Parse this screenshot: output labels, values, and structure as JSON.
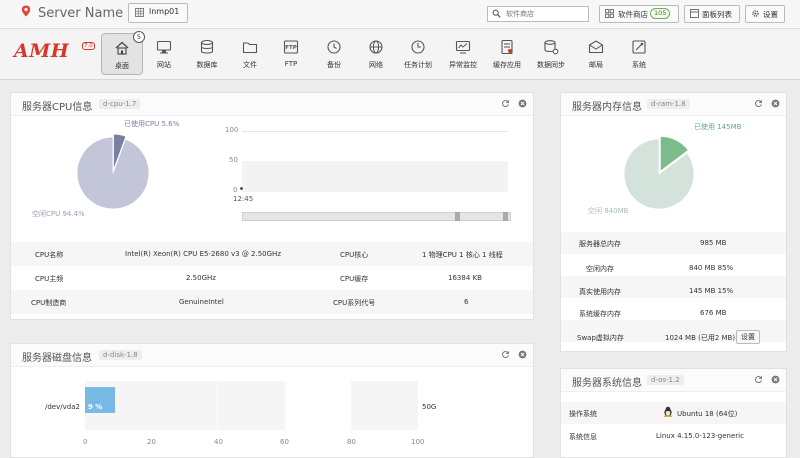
{
  "topbar": {
    "server_name": "Server Name",
    "host": "lnmp01",
    "search_placeholder": "软件商店",
    "store_label": "软件商店",
    "store_count": "105",
    "panel_list_label": "面板列表",
    "settings_label": "设置"
  },
  "logo": {
    "text": "AMH",
    "version": "7.0"
  },
  "nav": {
    "items": [
      {
        "label": "桌面",
        "icon": "desktop-icon",
        "badge": "5",
        "active": true
      },
      {
        "label": "网站",
        "icon": "monitor-icon"
      },
      {
        "label": "数据库",
        "icon": "database-icon"
      },
      {
        "label": "文件",
        "icon": "folder-icon"
      },
      {
        "label": "FTP",
        "icon": "ftp-icon"
      },
      {
        "label": "备份",
        "icon": "backup-icon"
      },
      {
        "label": "网络",
        "icon": "globe-icon"
      },
      {
        "label": "任务计划",
        "icon": "clock-icon"
      },
      {
        "label": "异常监控",
        "icon": "monitor-chart-icon"
      },
      {
        "label": "缓存应用",
        "icon": "cache-icon"
      },
      {
        "label": "数据同步",
        "icon": "sync-icon"
      },
      {
        "label": "邮局",
        "icon": "mail-icon"
      },
      {
        "label": "系统",
        "icon": "system-icon"
      }
    ]
  },
  "cpu_panel": {
    "title": "服务器CPU信息",
    "tag": "d-cpu-1.7",
    "used_label": "已使用CPU 5.6%",
    "free_label": "空闲CPU 94.4%",
    "y_ticks": [
      "100",
      "50",
      "0"
    ],
    "x_tick": "12:45",
    "rows": [
      {
        "k1": "CPU名称",
        "v1": "Intel(R) Xeon(R) CPU E5-2680 v3 @ 2.50GHz",
        "k2": "CPU核心",
        "v2": "1 物理CPU   1 核心   1 线程"
      },
      {
        "k1": "CPU主频",
        "v1": "2.50GHz",
        "k2": "CPU缓存",
        "v2": "16384 KB"
      },
      {
        "k1": "CPU制造商",
        "v1": "GenuineIntel",
        "k2": "CPU系列代号",
        "v2": "6"
      }
    ]
  },
  "disk_panel": {
    "title": "服务器磁盘信息",
    "tag": "d-disk-1.8",
    "device": "/dev/vda2",
    "used_pct_label": "9 %",
    "size": "50G",
    "x_ticks": [
      "0",
      "20",
      "40",
      "60",
      "80",
      "100"
    ]
  },
  "ram_panel": {
    "title": "服务器内存信息",
    "tag": "d-ram-1.8",
    "used_label": "已使用 145MB",
    "free_label": "空闲 840MB",
    "rows": [
      {
        "k": "服务器总内存",
        "v": "985 MB"
      },
      {
        "k": "空闲内存",
        "v": "840 MB   85%"
      },
      {
        "k": "真实使用内存",
        "v": "145 MB   15%"
      },
      {
        "k": "系统缓存内存",
        "v": "676 MB"
      },
      {
        "k": "Swap虚拟内存",
        "v": "1024 MB (已用2 MB)"
      }
    ],
    "swap_button": "设置"
  },
  "os_panel": {
    "title": "服务器系统信息",
    "tag": "d-os-1.2",
    "rows": [
      {
        "k": "操作系统",
        "v": "Ubuntu 18 (64位)"
      },
      {
        "k": "系统信息",
        "v": "Linux 4.15.0-123-generic"
      }
    ]
  },
  "chart_data": [
    {
      "type": "pie",
      "labels": [
        "已使用CPU",
        "空闲CPU"
      ],
      "values": [
        5.6,
        94.4
      ],
      "colors": [
        "#7b80a0",
        "#c3c5d8"
      ]
    },
    {
      "type": "pie",
      "labels": [
        "已使用",
        "空闲"
      ],
      "values": [
        145,
        840
      ],
      "colors": [
        "#7dbb8c",
        "#d4e2dc"
      ]
    },
    {
      "type": "bar",
      "categories": [
        "/dev/vda2"
      ],
      "values": [
        9
      ],
      "xlim": [
        0,
        100
      ],
      "colors": [
        "#79b9e6"
      ]
    },
    {
      "type": "line",
      "x": [
        "12:45"
      ],
      "values": [
        0
      ],
      "ylim": [
        0,
        100
      ]
    }
  ]
}
